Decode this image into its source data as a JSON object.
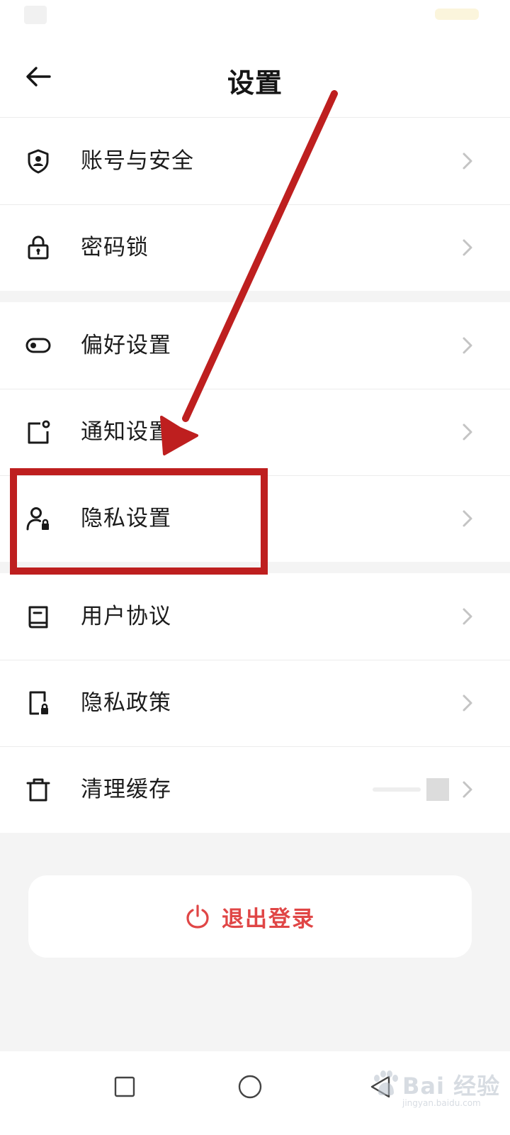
{
  "header": {
    "title": "设置"
  },
  "groups": [
    {
      "items": [
        {
          "label": "账号与安全",
          "icon": "shield-user-icon"
        },
        {
          "label": "密码锁",
          "icon": "padlock-icon"
        }
      ]
    },
    {
      "items": [
        {
          "label": "偏好设置",
          "icon": "toggle-icon"
        },
        {
          "label": "通知设置",
          "icon": "notification-icon"
        },
        {
          "label": "隐私设置",
          "icon": "user-lock-icon"
        }
      ]
    },
    {
      "items": [
        {
          "label": "用户协议",
          "icon": "book-icon"
        },
        {
          "label": "隐私政策",
          "icon": "document-lock-icon"
        },
        {
          "label": "清理缓存",
          "icon": "trash-icon"
        }
      ]
    }
  ],
  "logout": {
    "label": "退出登录",
    "icon": "power-icon"
  },
  "nav": {
    "icons": [
      "recent-apps-icon",
      "home-icon",
      "back-icon"
    ]
  },
  "watermark": {
    "brand": "Bai 经验",
    "url": "jingyan.baidu.com"
  },
  "colors": {
    "accent_red": "#e04646",
    "annotation_red": "#be1f1f",
    "background": "#f4f4f4"
  }
}
